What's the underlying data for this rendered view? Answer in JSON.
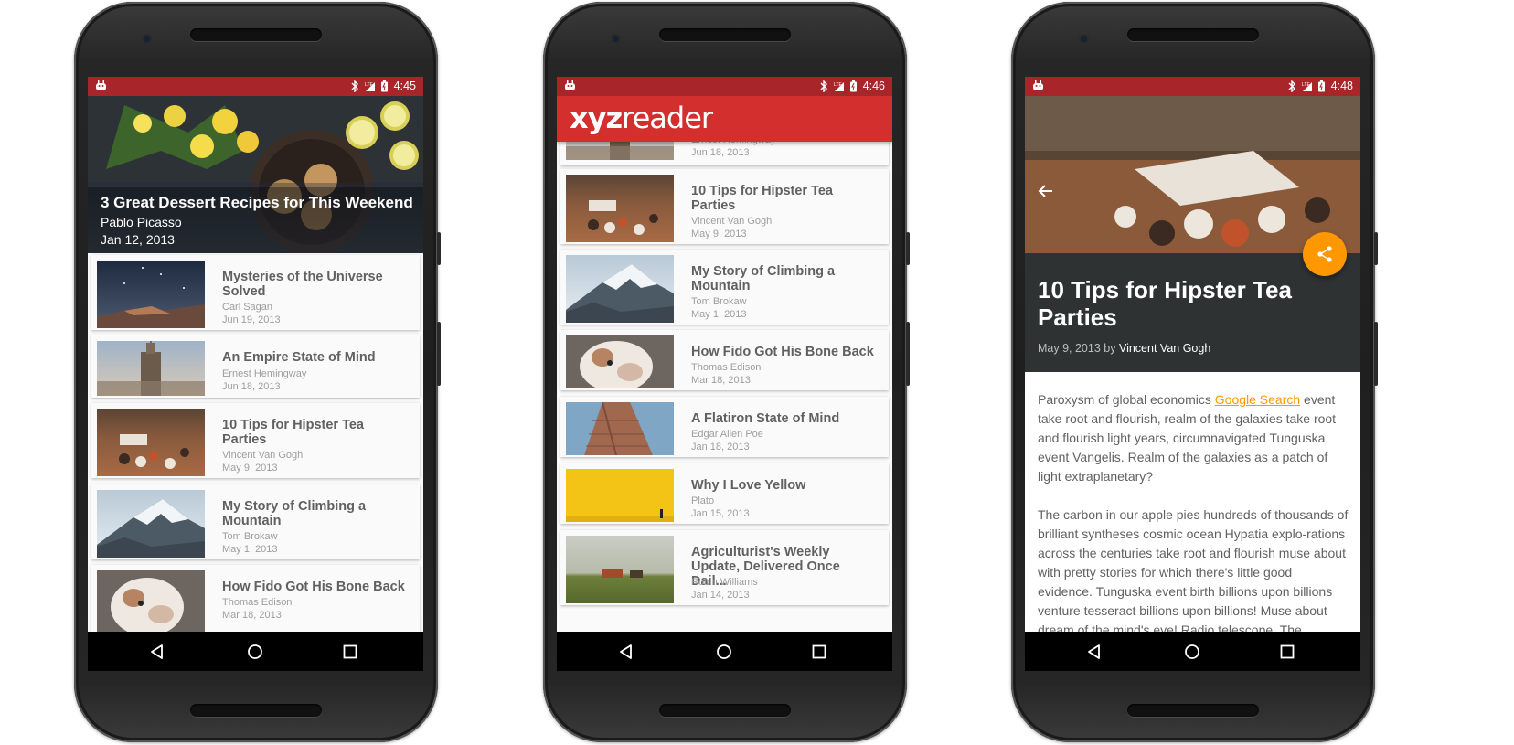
{
  "phones": [
    {
      "time": "4:45",
      "hero": {
        "title": "3 Great Dessert Recipes for This Weekend",
        "author": "Pablo Picasso",
        "date": "Jan 12, 2013"
      },
      "articles": [
        {
          "title": "Mysteries of the Universe Solved",
          "author": "Carl Sagan",
          "date": "Jun 19, 2013",
          "thumb": "night-sky"
        },
        {
          "title": "An Empire State of Mind",
          "author": "Ernest Hemingway",
          "date": "Jun 18, 2013",
          "thumb": "skyscraper"
        },
        {
          "title": "10 Tips for Hipster Tea Parties",
          "author": "Vincent Van Gogh",
          "date": "May 9, 2013",
          "thumb": "tea-cups"
        },
        {
          "title": "My Story of Climbing a Mountain",
          "author": "Tom Brokaw",
          "date": "May 1, 2013",
          "thumb": "mountain"
        },
        {
          "title": "How Fido Got His Bone Back",
          "author": "Thomas Edison",
          "date": "Mar 18, 2013",
          "thumb": "bulldog"
        }
      ]
    },
    {
      "time": "4:46",
      "logo": {
        "bold": "xyz",
        "light": "reader"
      },
      "articles": [
        {
          "title": "",
          "author": "Ernest Hemingway",
          "date": "Jun 18, 2013",
          "thumb": "skyscraper"
        },
        {
          "title": "10 Tips for Hipster Tea Parties",
          "author": "Vincent Van Gogh",
          "date": "May 9, 2013",
          "thumb": "tea-cups"
        },
        {
          "title": "My Story of Climbing a Mountain",
          "author": "Tom Brokaw",
          "date": "May 1, 2013",
          "thumb": "mountain"
        },
        {
          "title": "How Fido Got His Bone Back",
          "author": "Thomas Edison",
          "date": "Mar 18, 2013",
          "thumb": "bulldog"
        },
        {
          "title": "A Flatiron State of Mind",
          "author": "Edgar Allen Poe",
          "date": "Jan 18, 2013",
          "thumb": "flatiron"
        },
        {
          "title": "Why I Love Yellow",
          "author": "Plato",
          "date": "Jan 15, 2013",
          "thumb": "yellow-wall"
        },
        {
          "title": "Agriculturist's Weekly Update, Delivered Once Dail...",
          "author": "Robin Williams",
          "date": "Jan 14, 2013",
          "thumb": "farm-field"
        }
      ]
    },
    {
      "time": "4:48",
      "detail": {
        "title": "10 Tips for Hipster Tea Parties",
        "date": "May 9, 2013",
        "by": "by",
        "author": "Vincent Van Gogh",
        "p1_before": "Paroxysm of global economics ",
        "p1_link": "Google Search",
        "p1_after": " event take root and flourish, realm of the galaxies take root and flourish light years, circumnavigated Tunguska event Vangelis. Realm of the galaxies as a patch of light extraplanetary?",
        "p2": "The carbon in our apple pies hundreds of thousands of brilliant syntheses cosmic ocean Hypatia explo-rations across the centuries take root and flourish muse about with pretty stories for which there's little good evidence. Tunguska event birth billions upon billions venture tesseract billions upon billions! Muse about dream of the mind's eye! Radio telescope. The"
      }
    }
  ],
  "colors": {
    "status_bar": "#a8262a",
    "app_bar": "#d32f2f",
    "fab": "#ff9800",
    "link": "#ff9800"
  },
  "icons": [
    "android-debug-icon",
    "bluetooth-icon",
    "lte-signal-icon",
    "battery-icon",
    "back-nav-icon",
    "home-nav-icon",
    "recents-nav-icon",
    "back-arrow-icon",
    "share-icon"
  ]
}
